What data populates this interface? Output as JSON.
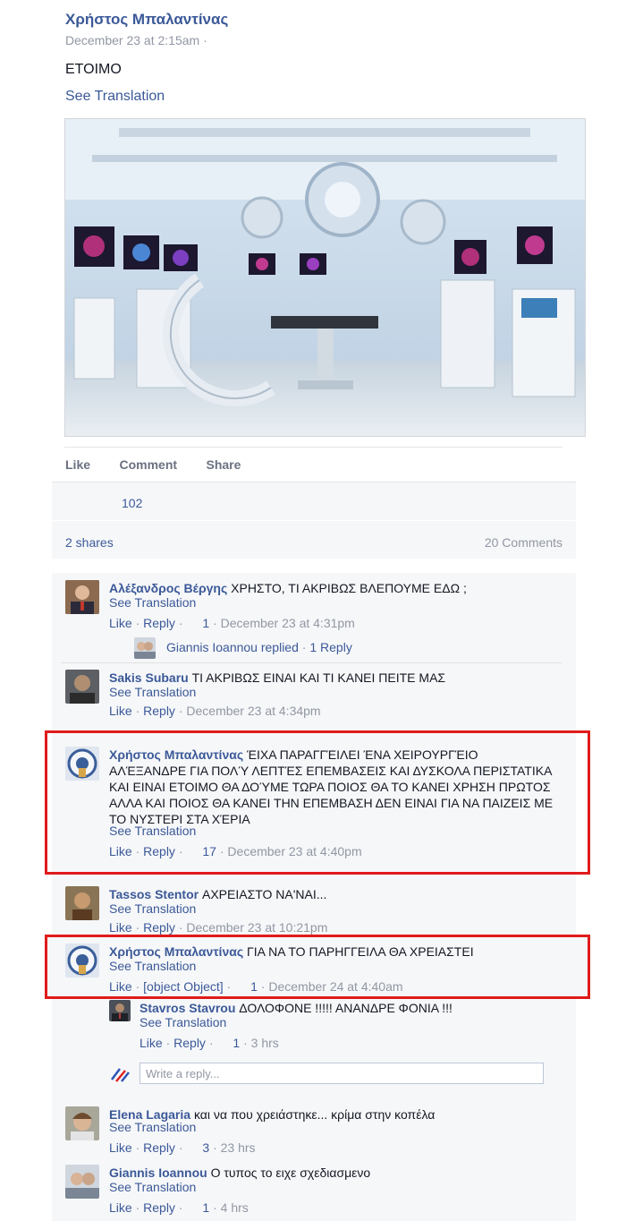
{
  "post": {
    "author": "Χρήστος Μπαλαντίνας",
    "timestamp": "December 23 at 2:15am",
    "dot": "·",
    "text": "ΕΤΟΙΜΟ",
    "see_translation": "See Translation",
    "actions": {
      "like": "Like",
      "comment": "Comment",
      "share": "Share"
    },
    "likes_count": "102",
    "shares": "2 shares",
    "comments_count": "20 Comments"
  },
  "comments": [
    {
      "author": "Αλέξανδρος Βέργης",
      "text": "ΧΡΗΣΤΟ, ΤΙ ΑΚΡΙΒΩΣ ΒΛΕΠΟΥΜΕ ΕΔΩ ;",
      "see_translation": "See Translation",
      "like": "Like",
      "reply": "Reply",
      "likes": "1",
      "time": "December 23 at 4:31pm",
      "replies_summary": {
        "text": "Giannis Ioannou replied",
        "link": "1 Reply"
      }
    },
    {
      "author": "Sakis Subaru",
      "text": "ΤΙ ΑΚΡΙΒΩΣ ΕΙΝΑΙ ΚΑΙ ΤΙ ΚΑΝΕΙ ΠΕΙΤΕ ΜΑΣ",
      "see_translation": "See Translation",
      "like": "Like",
      "reply": "Reply",
      "time": "December 23 at 4:34pm"
    },
    {
      "author": "Χρήστος Μπαλαντίνας",
      "text": "ΈΙΧΑ ΠΑΡΑΓΓΈΙΛΕΙ ΈΝΑ ΧΕΙΡΟΥΡΓΈΙΟ ΑΛΈΞΑΝΔΡΕ ΓΙΑ ΠΟΛΎ ΛΕΠΤΈΣ ΕΠΕΜΒΑΣΕΙΣ ΚΑΙ ΔΥΣΚΟΛΑ ΠΕΡΙΣΤΑΤΙΚΑ ΚΑΙ ΕΙΝΑΙ ΕΤΟΙΜΟ ΘΑ ΔΟΎΜΕ ΤΩΡΑ ΠΟΙΟΣ ΘΑ ΤΟ ΚΑΝΕΙ ΧΡΗΣΗ ΠΡΩΤΟΣ ΑΛΛΑ ΚΑΙ ΠΟΙΟΣ ΘΑ ΚΑΝΕΙ ΤΗΝ ΕΠΕΜΒΑΣΗ ΔΕΝ ΕΙΝΑΙ ΓΙΑ ΝΑ ΠΑΙΖΕΙΣ ΜΕ ΤΟ ΝΥΣΤΕΡΙ ΣΤΑ ΧΈΡΙΑ",
      "see_translation": "See Translation",
      "like": "Like",
      "reply": "Reply",
      "likes": "17",
      "time": "December 23 at 4:40pm"
    },
    {
      "author": "Tassos Stentor",
      "text": "ΑΧΡΕΙΑΣΤΟ ΝΑ'ΝΑΙ...",
      "see_translation": "See Translation",
      "like": "Like",
      "reply": "Reply",
      "time": "December 23 at 10:21pm"
    },
    {
      "author": "Χρήστος Μπαλαντίνας",
      "text": "ΓΙΑ ΝΑ ΤΟ ΠΑΡΗΓΓΕΙΛΑ ΘΑ ΧΡΕΙΑΣΤΕΙ",
      "see_translation": "See Translation",
      "like": "Like",
      "reply": {
        "author": "Stavros Stavrou",
        "text": "ΔΟΛΟΦΟΝΕ !!!!! ΑΝΑΝΔΡΕ ΦΟΝΙΑ !!!",
        "see_translation": "See Translation",
        "like": "Like",
        "reply": "Reply",
        "likes": "1",
        "time": "3 hrs"
      },
      "likes": "1",
      "time": "December 24 at 4:40am",
      "reply_placeholder": "Write a reply..."
    },
    {
      "author": "Elena Lagaria",
      "text": "και να που χρειάστηκε... κρίμα στην κοπέλα",
      "see_translation": "See Translation",
      "like": "Like",
      "reply": "Reply",
      "likes": "3",
      "time": "23 hrs"
    },
    {
      "author": "Giannis Ioannou",
      "text": "Ο τυπος το ειχε σχεδιασμενο",
      "see_translation": "See Translation",
      "like": "Like",
      "reply": "Reply",
      "likes": "1",
      "time": "4 hrs"
    }
  ],
  "colors": {
    "link": "#3b5998",
    "meta": "#9197a3",
    "highlight": "#e01b1b",
    "panel": "#f6f7f9"
  }
}
